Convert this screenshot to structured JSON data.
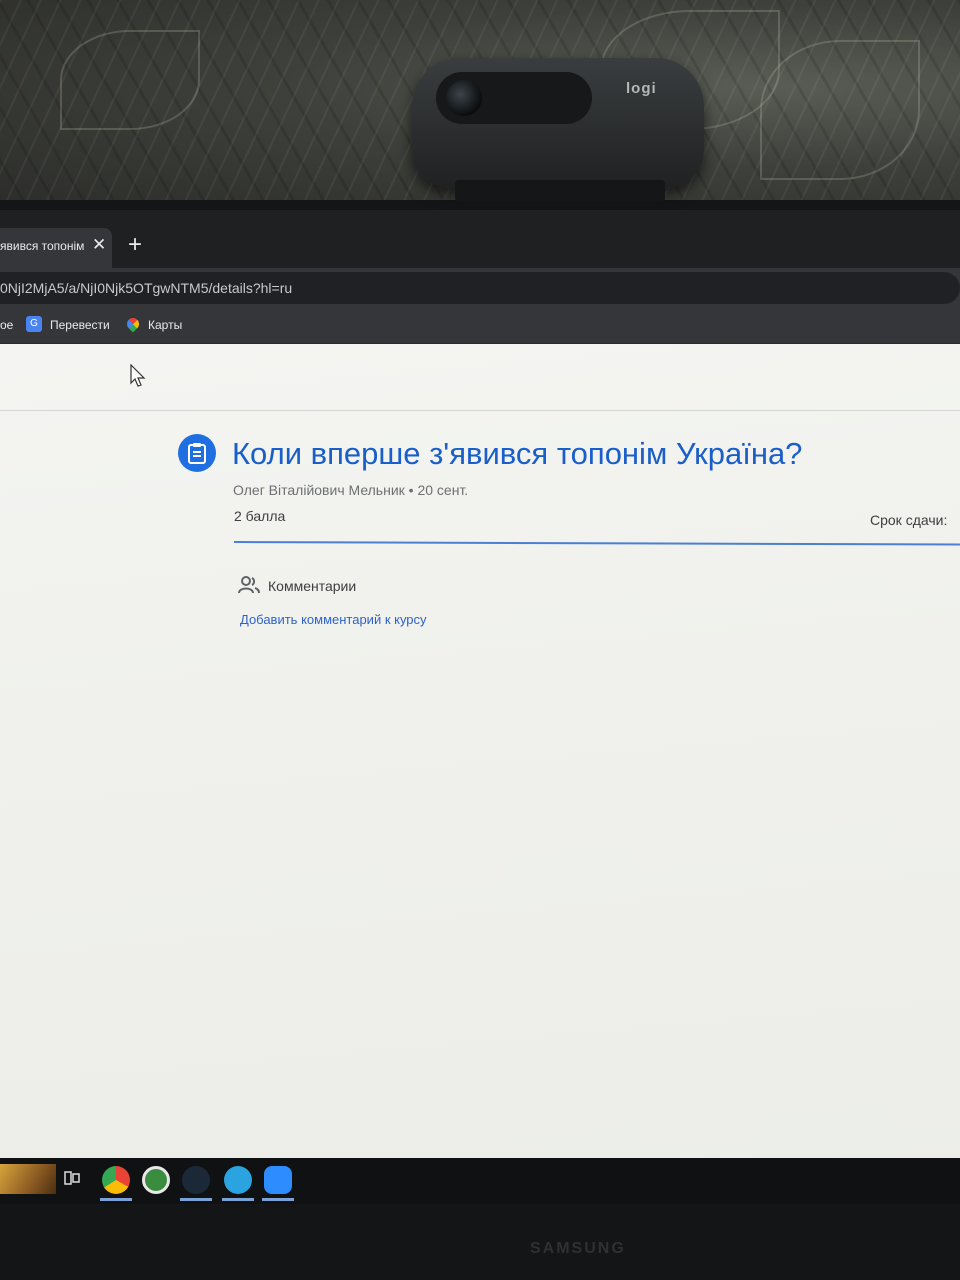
{
  "browser": {
    "tab_title": "явився топонім",
    "tab_close": "✕",
    "new_tab": "+",
    "url": "0NjI2MjA5/a/NjI0Njk5OTgwNTM5/details?hl=ru",
    "bookmarks": [
      {
        "label": "ое",
        "icon": "folder-icon"
      },
      {
        "label": "Перевести",
        "icon": "google-translate-icon"
      },
      {
        "label": "Карты",
        "icon": "google-maps-icon"
      }
    ]
  },
  "assignment": {
    "icon": "assignment-icon",
    "title": "Коли вперше з'явився топонім Україна?",
    "author_line": "Олег Віталійович Мельник • 20 сент.",
    "points": "2 балла",
    "due_label": "Срок сдачи:",
    "accent_color": "#1f6fe0"
  },
  "comments": {
    "label": "Комментарии",
    "add_link": "Добавить комментарий к курсу"
  },
  "webcam": {
    "brand": "logi"
  },
  "monitor": {
    "brand": "SAMSUNG"
  },
  "taskbar": {
    "items": [
      "task-view-icon",
      "chrome-icon",
      "app-icon",
      "steam-icon",
      "telegram-icon",
      "zoom-icon"
    ]
  }
}
